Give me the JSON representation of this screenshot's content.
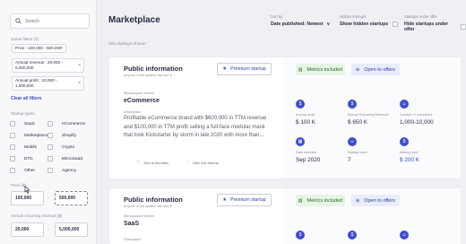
{
  "sidebar": {
    "search_placeholder": "Search",
    "active_filters_label": "Active filters (3)",
    "filters": [
      {
        "line1": "Price : 100,000 - 500,000"
      },
      {
        "line1": "Annual revenue : 20,000 -",
        "line2": "5,000,000"
      },
      {
        "line1": "Annual profit : 10,000 -",
        "line2": "1,000,000"
      }
    ],
    "clear_label": "Clear all filters",
    "types_label": "Startup types",
    "types": [
      "SaaS",
      "eCommerce",
      "Marketplace",
      "Shopify",
      "Mobile",
      "Crypto",
      "DTC",
      "MicroSaaS",
      "Other",
      "Agency"
    ],
    "price_label": "Price ($)",
    "price_min": "100,000",
    "price_max": "500,000",
    "arr_label": "Annual recurring revenue ($)",
    "arr_min": "20,000",
    "arr_max": "5,000,000",
    "separator": "-"
  },
  "header": {
    "title": "Marketplace",
    "sort_label": "Sort by",
    "sort_value": "Date published: Newest",
    "sort_chevron": "∨",
    "hidden_label": "Hidden startups",
    "hidden_value": "Show hidden startups",
    "offer_label": "Startups under offer",
    "offer_value": "Hide startups under offer",
    "count": "165 startups shown"
  },
  "cards": [
    {
      "pi_title": "Public information",
      "pi_sub": "Anyone in the system can see it",
      "premium": "Premium startup",
      "type_label": "Microacquire review",
      "type_value": "eCommerce",
      "desc_label": "Description",
      "description": "Profitable eCommerce brand with $600,000 in TTM revenue and $100,000 in TTM profit selling a full-face modular mask that took Kickstarter by storm in late 2020 with more than...",
      "fav": "Add to favorites",
      "hide": "Hide this startup",
      "metrics_badge": "Metrics included",
      "offers_badge": "Open to offers",
      "metrics": [
        {
          "label": "Annual profit",
          "value": "$ 100 K",
          "icon": "$"
        },
        {
          "label": "Annual Recurring Revenue",
          "value": "$ 650 K",
          "icon": "$"
        },
        {
          "label": "Number of customers",
          "value": "1,000-10,000",
          "icon": "☺"
        },
        {
          "label": "Date founded",
          "value": "Sep 2020",
          "icon": "▦"
        },
        {
          "label": "Startup team",
          "value": "7",
          "icon": "☺"
        },
        {
          "label": "Asking price",
          "value": "$ 200 K",
          "icon": "$"
        }
      ]
    },
    {
      "pi_title": "Public information",
      "pi_sub": "Anyone in the system can see it",
      "premium": "Premium startup",
      "type_label": "Microacquire review",
      "type_value": "SaaS",
      "desc_label": "Description",
      "metrics_badge": "Metrics included",
      "offers_badge": "Open to offers",
      "icons": [
        "$",
        "$",
        "☺"
      ]
    }
  ],
  "colors": {
    "accent": "#3e4bd1",
    "green_badge": "#e6f5e4",
    "blue_badge": "#e8ecfb"
  }
}
